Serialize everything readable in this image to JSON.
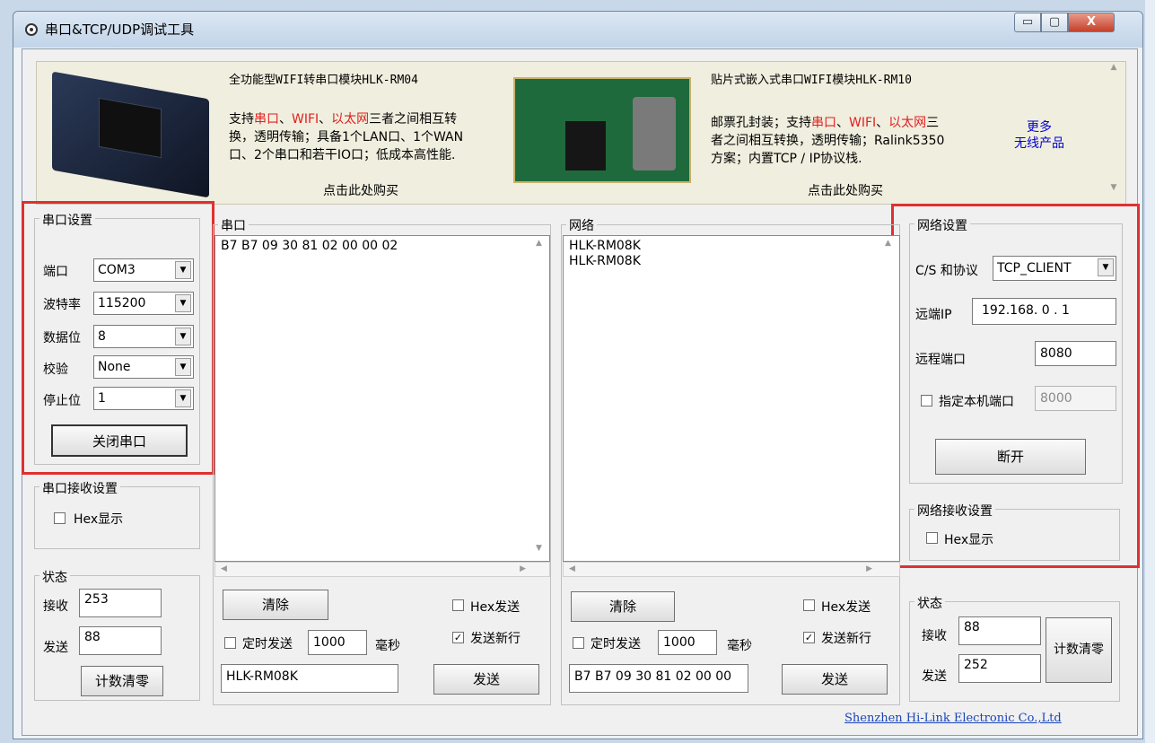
{
  "window": {
    "title": "串口&TCP/UDP调试工具",
    "min_label": "▭",
    "max_label": "▢",
    "close_label": "X"
  },
  "banner": {
    "left": {
      "title": "全功能型WIFI转串口模块HLK-RM04",
      "line1a": "支持",
      "hl1": "串口",
      "sep1": "、",
      "hl2": "WIFI",
      "sep2": "、",
      "hl3": "以太网",
      "line1b": "三者之间相互转",
      "line2": "换，透明传输；具备1个LAN口、1个WAN",
      "line3": "口、2个串口和若干IO口；低成本高性能.",
      "buy": "点击此处购买"
    },
    "right": {
      "title": "贴片式嵌入式串口WIFI模块HLK-RM10",
      "line1a": "邮票孔封装；支持",
      "hl1": "串口",
      "sep1": "、",
      "hl2": "WIFI",
      "sep2": "、",
      "hl3": "以太网",
      "line1b": "三",
      "line2": "者之间相互转换，透明传输；Ralink5350",
      "line3": "方案；内置TCP / IP协议栈.",
      "buy": "点击此处购买"
    },
    "more": "更多",
    "more2": "无线产品"
  },
  "serial_settings": {
    "group_title": "串口设置",
    "port_label": "端口",
    "port_value": "COM3",
    "baud_label": "波特率",
    "baud_value": "115200",
    "databits_label": "数据位",
    "databits_value": "8",
    "parity_label": "校验",
    "parity_value": "None",
    "stopbits_label": "停止位",
    "stopbits_value": "1",
    "close_button": "关闭串口"
  },
  "serial_recv_settings": {
    "group_title": "串口接收设置",
    "hex_label": "Hex显示"
  },
  "serial_status": {
    "group_title": "状态",
    "recv_label": "接收",
    "recv_value": "253",
    "send_label": "发送",
    "send_value": "88",
    "clear_button": "计数清零"
  },
  "serial_panel": {
    "group_title": "串口",
    "text": "B7 B7 09 30 81 02 00 00 02",
    "clear_button": "清除",
    "hex_send_label": "Hex发送",
    "newline_label": "发送新行",
    "timer_label": "定时发送",
    "timer_value": "1000",
    "ms_label": "毫秒",
    "send_input": "HLK-RM08K",
    "send_button": "发送"
  },
  "network_panel": {
    "group_title": "网络",
    "lines": [
      "HLK-RM08K",
      "HLK-RM08K"
    ],
    "clear_button": "清除",
    "hex_send_label": "Hex发送",
    "newline_label": "发送新行",
    "timer_label": "定时发送",
    "timer_value": "1000",
    "ms_label": "毫秒",
    "send_input": "B7 B7 09 30 81 02 00 00",
    "send_button": "发送"
  },
  "network_settings": {
    "group_title": "网络设置",
    "cs_label": "C/S 和协议",
    "cs_value": "TCP_CLIENT",
    "ip_label": "远端IP",
    "ip_value": "192.168. 0 . 1",
    "rport_label": "远程端口",
    "rport_value": "8080",
    "lport_label": "指定本机端口",
    "lport_value": "8000",
    "disconnect_button": "断开"
  },
  "network_recv_settings": {
    "group_title": "网络接收设置",
    "hex_label": "Hex显示"
  },
  "network_status": {
    "group_title": "状态",
    "recv_label": "接收",
    "recv_value": "88",
    "send_label": "发送",
    "send_value": "252",
    "clear_button": "计数清零"
  },
  "footer": {
    "company": "Shenzhen Hi-Link Electronic Co.,Ltd"
  }
}
